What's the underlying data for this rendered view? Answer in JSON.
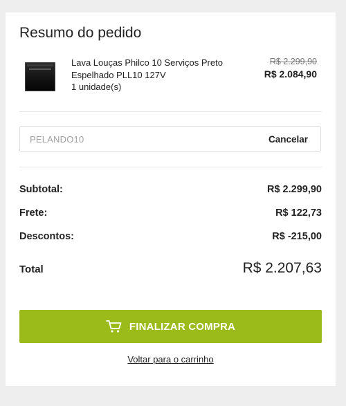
{
  "summary": {
    "title": "Resumo do pedido"
  },
  "product": {
    "name": "Lava Louças Philco 10 Serviços Preto Espelhado PLL10 127V",
    "quantity": "1 unidade(s)",
    "old_price": "R$ 2.299,90",
    "price": "R$ 2.084,90"
  },
  "coupon": {
    "code": "PELANDO10",
    "cancel_label": "Cancelar"
  },
  "totals": {
    "subtotal_label": "Subtotal:",
    "subtotal_value": "R$ 2.299,90",
    "shipping_label": "Frete:",
    "shipping_value": "R$ 122,73",
    "discounts_label": "Descontos:",
    "discounts_value": "R$ -215,00",
    "total_label": "Total",
    "total_value": "R$ 2.207,63"
  },
  "actions": {
    "checkout_label": "FINALIZAR COMPRA",
    "back_label": "Voltar para o carrinho"
  },
  "colors": {
    "accent": "#9bbb1b",
    "background": "#eeeeee",
    "card": "#ffffff"
  },
  "icons": {
    "cart": "cart-icon"
  }
}
